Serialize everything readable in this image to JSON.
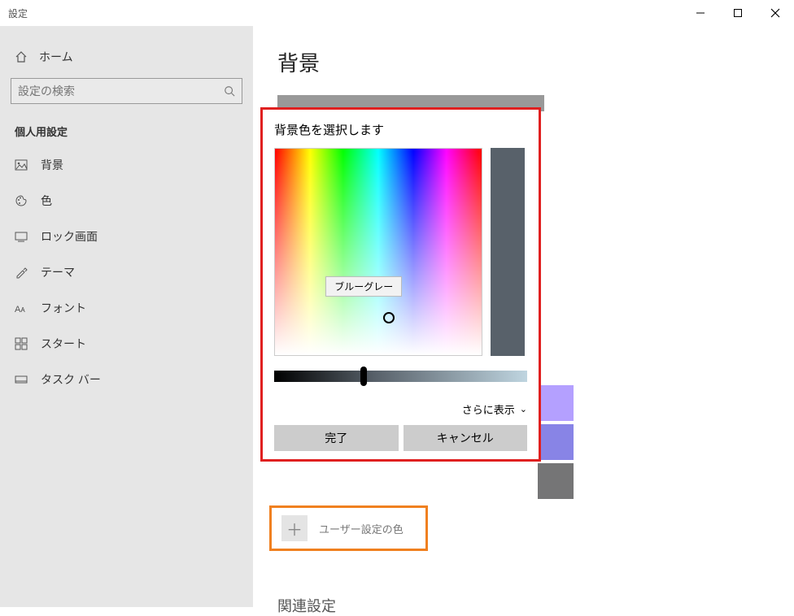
{
  "window": {
    "title": "設定"
  },
  "sidebar": {
    "home": "ホーム",
    "search_placeholder": "設定の検索",
    "section": "個人用設定",
    "items": [
      {
        "label": "背景",
        "icon": "image-icon"
      },
      {
        "label": "色",
        "icon": "palette-icon"
      },
      {
        "label": "ロック画面",
        "icon": "lock-screen-icon"
      },
      {
        "label": "テーマ",
        "icon": "theme-icon"
      },
      {
        "label": "フォント",
        "icon": "font-icon"
      },
      {
        "label": "スタート",
        "icon": "start-icon"
      },
      {
        "label": "タスク バー",
        "icon": "taskbar-icon"
      }
    ]
  },
  "main": {
    "title": "背景",
    "custom_color_label": "ユーザー設定の色",
    "related_heading": "関連設定",
    "swatches": [
      {
        "color": "#b4a0ff"
      },
      {
        "color": "#8884e6"
      },
      {
        "color": "#757576"
      }
    ]
  },
  "dialog": {
    "title": "背景色を選択します",
    "tooltip": "ブルーグレー",
    "preview_color": "#58616a",
    "more_label": "さらに表示",
    "ok_label": "完了",
    "cancel_label": "キャンセル"
  }
}
